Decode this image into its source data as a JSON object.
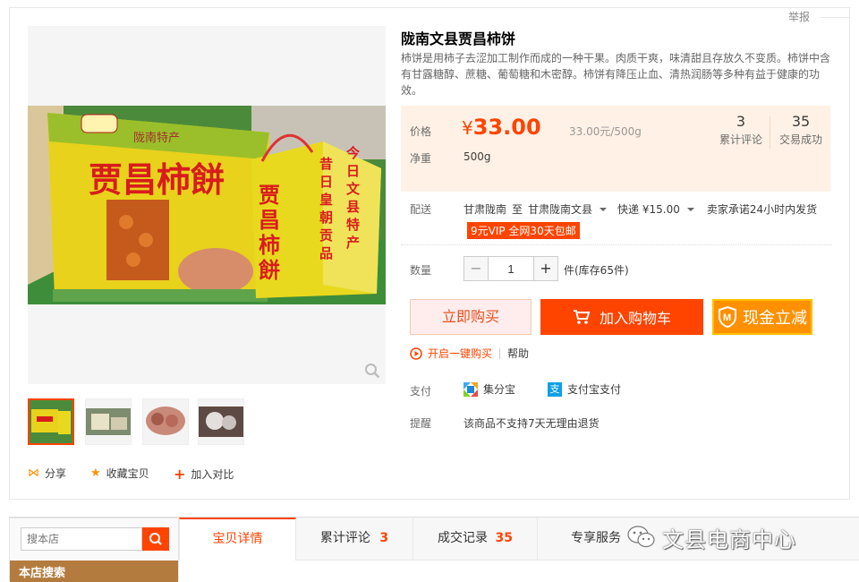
{
  "card": {
    "report_label": "举报"
  },
  "product": {
    "title": "陇南文县贾昌柿饼",
    "description": "柿饼是用柿子去涩加工制作而成的一种干果。肉质干爽，味清甜且存放久不变质。柿饼中含有甘露糖醇、蔗糖、葡萄糖和木密醇。柿饼有降压止血、清热润肠等多种有益于健康的功效。"
  },
  "photo_text": {
    "box_front_logo": "陇南特产",
    "box_front_title": "贾昌柿餅",
    "bag_text_left": "昔日皇朝贡品",
    "bag_text_right": "今日文县特产"
  },
  "price": {
    "label": "价格",
    "currency": "¥",
    "value": "33.00",
    "unit_price": "33.00元/500g",
    "weight_label": "净重",
    "weight_value": "500g"
  },
  "stats": [
    {
      "count": "3",
      "label": "累计评论"
    },
    {
      "count": "35",
      "label": "交易成功"
    }
  ],
  "delivery": {
    "label": "配送",
    "from": "甘肃陇南",
    "to_word": "至",
    "to": "甘肃陇南文县",
    "express": "快递 ¥15.00",
    "promise": "卖家承诺24小时内发货",
    "vip_badge": "9元VIP 全网30天包邮"
  },
  "quantity": {
    "label": "数量",
    "value": "1",
    "minus": "−",
    "plus": "+",
    "stock": "件(库存65件)"
  },
  "actions": {
    "buy_now": "立即购买",
    "add_cart": "加入购物车",
    "cash_discount": "现金立减",
    "cash_icon_letter": "M",
    "one_click": "开启一键购买",
    "help": "帮助"
  },
  "payment": {
    "label": "支付",
    "methods": [
      "集分宝",
      "支付宝支付"
    ],
    "alipay_icon_char": "支"
  },
  "reminder": {
    "label": "提醒",
    "text": "该商品不支持7天无理由退货"
  },
  "gallery_ops": {
    "share": "分享",
    "favorite": "收藏宝贝",
    "compare": "加入对比"
  },
  "shop_search": {
    "placeholder": "搜本店",
    "category_title": "本店搜索"
  },
  "tabs": [
    {
      "label": "宝贝详情"
    },
    {
      "label": "累计评论",
      "count": "3"
    },
    {
      "label": "成交记录",
      "count": "35"
    },
    {
      "label": "专享服务"
    }
  ],
  "watermark": "文县电商中心",
  "colors": {
    "accent": "#ff4400",
    "price_bg": "#fff1e5",
    "cash_button": "#ff9000",
    "category_bar": "#b47b3f"
  },
  "icons": {
    "zoom": "magnifier-icon",
    "share": "share-icon",
    "favorite": "star-icon",
    "compare": "plus-icon",
    "cart": "cart-icon",
    "shield": "shield-icon",
    "one_click": "play-circle-icon",
    "jifenbao": "jifenbao-icon",
    "alipay": "alipay-icon",
    "search": "search-icon",
    "wechat": "wechat-icon"
  }
}
